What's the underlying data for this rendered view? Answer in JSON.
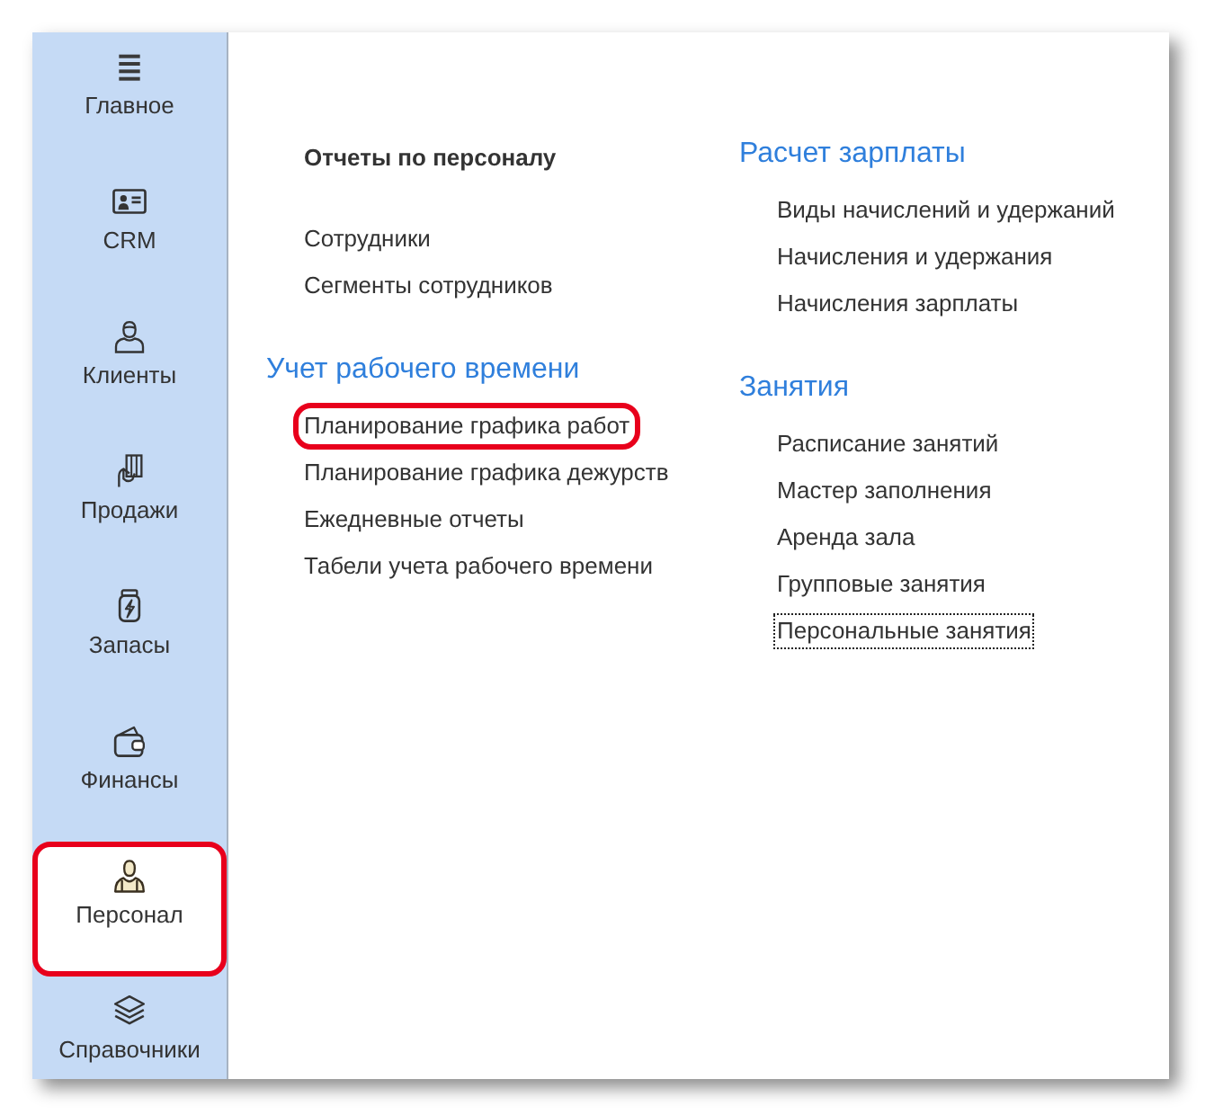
{
  "sidebar": {
    "items": [
      {
        "label": "Главное",
        "kind": "menu",
        "selected": false,
        "highlighted": false
      },
      {
        "label": "CRM",
        "kind": "card",
        "selected": false,
        "highlighted": false
      },
      {
        "label": "Клиенты",
        "kind": "person",
        "selected": false,
        "highlighted": false
      },
      {
        "label": "Продажи",
        "kind": "hand",
        "selected": false,
        "highlighted": false
      },
      {
        "label": "Запасы",
        "kind": "can",
        "selected": false,
        "highlighted": false
      },
      {
        "label": "Финансы",
        "kind": "wallet",
        "selected": false,
        "highlighted": false
      },
      {
        "label": "Персонал",
        "kind": "staff",
        "selected": true,
        "highlighted": true
      },
      {
        "label": "Справочники",
        "kind": "stack",
        "selected": false,
        "highlighted": false
      }
    ]
  },
  "columns": [
    {
      "sections": [
        {
          "kind": "subheader",
          "title": "Отчеты по персоналу",
          "items": [
            {
              "label": "Сотрудники",
              "highlighted": false,
              "focused": false
            },
            {
              "label": "Сегменты сотрудников",
              "highlighted": false,
              "focused": false
            }
          ]
        },
        {
          "kind": "header",
          "title": "Учет рабочего времени",
          "items": [
            {
              "label": "Планирование графика работ",
              "highlighted": true,
              "focused": false
            },
            {
              "label": "Планирование графика дежурств",
              "highlighted": false,
              "focused": false
            },
            {
              "label": "Ежедневные отчеты",
              "highlighted": false,
              "focused": false
            },
            {
              "label": "Табели учета рабочего времени",
              "highlighted": false,
              "focused": false
            }
          ]
        }
      ]
    },
    {
      "sections": [
        {
          "kind": "header",
          "title": "Расчет зарплаты",
          "items": [
            {
              "label": "Виды начислений и удержаний",
              "highlighted": false,
              "focused": false
            },
            {
              "label": "Начисления и удержания",
              "highlighted": false,
              "focused": false
            },
            {
              "label": "Начисления зарплаты",
              "highlighted": false,
              "focused": false
            }
          ]
        },
        {
          "kind": "header",
          "title": "Занятия",
          "items": [
            {
              "label": "Расписание занятий",
              "highlighted": false,
              "focused": false
            },
            {
              "label": "Мастер заполнения",
              "highlighted": false,
              "focused": false
            },
            {
              "label": "Аренда зала",
              "highlighted": false,
              "focused": false
            },
            {
              "label": "Групповые занятия",
              "highlighted": false,
              "focused": false
            },
            {
              "label": "Персональные занятия",
              "highlighted": false,
              "focused": true
            }
          ]
        }
      ]
    }
  ]
}
